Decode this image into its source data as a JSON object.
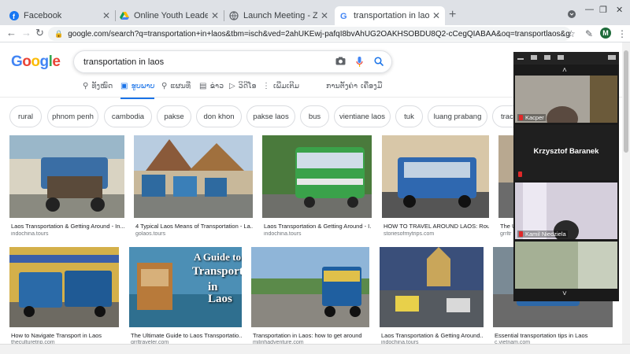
{
  "browser": {
    "tabs": [
      {
        "title": "Facebook",
        "close": "✕",
        "icon": "facebook-icon"
      },
      {
        "title": "Online Youth Leaders Tasks.xlsx",
        "close": "✕",
        "icon": "google-drive-icon"
      },
      {
        "title": "Launch Meeting - Zoom",
        "close": "✕",
        "icon": "globe-icon"
      },
      {
        "title": "transportation in laos - Google S",
        "close": "✕",
        "icon": "google-icon"
      }
    ],
    "new_tab": "+",
    "url": "google.com/search?q=transportation+in+laos&tbm=isch&ved=2ahUKEwj-pafqI8bvAhUG2OAKHSOBDU8Q2-cCegQIABAA&oq=transportlaos&gs_lcp=CgNpbWcQARgAMg...",
    "profile_initial": "M",
    "accent": "#1a73e8"
  },
  "google": {
    "logo": "Google",
    "query": "transportation in laos",
    "tabs": [
      {
        "label": "ທັງໝົດ",
        "icon": "search-icon",
        "active": false
      },
      {
        "label": "ຮູບພາບ",
        "icon": "image-icon",
        "active": true
      },
      {
        "label": "ແຜນທີ່",
        "icon": "map-pin-icon",
        "active": false
      },
      {
        "label": "ຂ່າວ",
        "icon": "news-icon",
        "active": false
      },
      {
        "label": "ວິດີໂອ",
        "icon": "video-icon",
        "active": false
      },
      {
        "label": "ເພີ່ມເຕີມ",
        "icon": "more-icon",
        "active": false
      }
    ],
    "tools": [
      "ການຕັ້ງຄ່າ",
      "ເຄື່ອງມື"
    ],
    "chips": [
      "rural",
      "phnom penh",
      "cambodia",
      "pakse",
      "don khon",
      "pakse laos",
      "bus",
      "vientiane laos",
      "tuk",
      "luang prabang",
      "tract"
    ],
    "results_row1": [
      {
        "caption": "Laos Transportation & Getting Around - In...",
        "source": "indochina.tours"
      },
      {
        "caption": "4 Typical Laos Means of Transportation - La...",
        "source": "golaos.tours"
      },
      {
        "caption": "Laos Transportation & Getting Around - I...",
        "source": "indochina.tours"
      },
      {
        "caption": "HOW TO TRAVEL AROUND LAOS: Route...",
        "source": "storiesofmytrips.com"
      },
      {
        "caption": "The U",
        "source": "grrltr"
      }
    ],
    "results_row2": [
      {
        "caption": "How to Navigate Transport in Laos",
        "source": "theculturetrip.com"
      },
      {
        "caption": "The Ultimate Guide to Laos Transportatio...",
        "source": "grrltraveler.com",
        "overlay": [
          "A Guide to",
          "Transportation",
          "in Laos"
        ]
      },
      {
        "caption": "Transportation in Laos: how to get around",
        "source": "milinhadventure.com"
      },
      {
        "caption": "Laos Transportation & Getting Around...",
        "source": "indochina.tours"
      },
      {
        "caption": "Essential transportation tips in Laos",
        "source": "c.vietnam.com"
      }
    ]
  },
  "zoom": {
    "participants": [
      {
        "name": "Kacper"
      },
      {
        "name": "Krzysztof Baranek"
      },
      {
        "name": "Kamil Niedziela"
      }
    ]
  }
}
